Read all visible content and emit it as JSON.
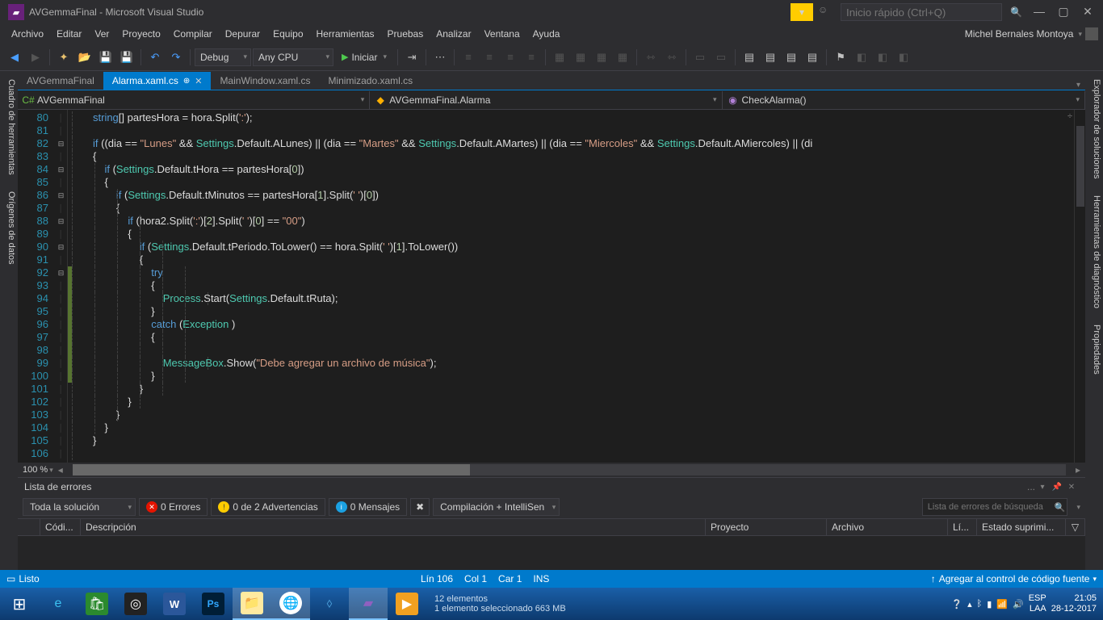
{
  "title": "AVGemmaFinal - Microsoft Visual Studio",
  "quickLaunch": "Inicio rápido (Ctrl+Q)",
  "user": "Michel Bernales Montoya",
  "menu": [
    "Archivo",
    "Editar",
    "Ver",
    "Proyecto",
    "Compilar",
    "Depurar",
    "Equipo",
    "Herramientas",
    "Pruebas",
    "Analizar",
    "Ventana",
    "Ayuda"
  ],
  "toolbar": {
    "config": "Debug",
    "platform": "Any CPU",
    "start": "Iniciar"
  },
  "leftPanels": [
    "Cuadro de herramientas",
    "Orígenes de datos"
  ],
  "rightPanels": [
    "Explorador de soluciones",
    "Herramientas de diagnóstico",
    "Propiedades"
  ],
  "tabs": {
    "project": "AVGemmaFinal",
    "active": "Alarma.xaml.cs",
    "t2": "MainWindow.xaml.cs",
    "t3": "Minimizado.xaml.cs"
  },
  "nav": {
    "scope": "AVGemmaFinal",
    "class": "AVGemmaFinal.Alarma",
    "member": "CheckAlarma()"
  },
  "lines": [
    "80",
    "81",
    "82",
    "83",
    "84",
    "85",
    "86",
    "87",
    "88",
    "89",
    "90",
    "91",
    "92",
    "93",
    "94",
    "95",
    "96",
    "97",
    "98",
    "99",
    "100",
    "101",
    "102",
    "103",
    "104",
    "105",
    "106"
  ],
  "zoom": "100 %",
  "errorList": {
    "title": "Lista de errores",
    "scope": "Toda la solución",
    "errors": "0 Errores",
    "warnings": "0 de 2 Advertencias",
    "messages": "0 Mensajes",
    "build": "Compilación + IntelliSen",
    "search": "Lista de errores de búsqueda",
    "cols": {
      "code": "Códi...",
      "desc": "Descripción",
      "proj": "Proyecto",
      "file": "Archivo",
      "line": "Lí...",
      "supp": "Estado suprimi..."
    }
  },
  "status": {
    "ready": "Listo",
    "ln": "Lín 106",
    "col": "Col 1",
    "car": "Car 1",
    "ins": "INS",
    "scc": "Agregar al control de código fuente"
  },
  "taskbarInfo": {
    "items": "12 elementos",
    "sel": "1 elemento seleccionado  663 MB"
  },
  "tray": {
    "lang": "ESP",
    "kb": "LAA",
    "time": "21:05",
    "date": "28-12-2017"
  }
}
